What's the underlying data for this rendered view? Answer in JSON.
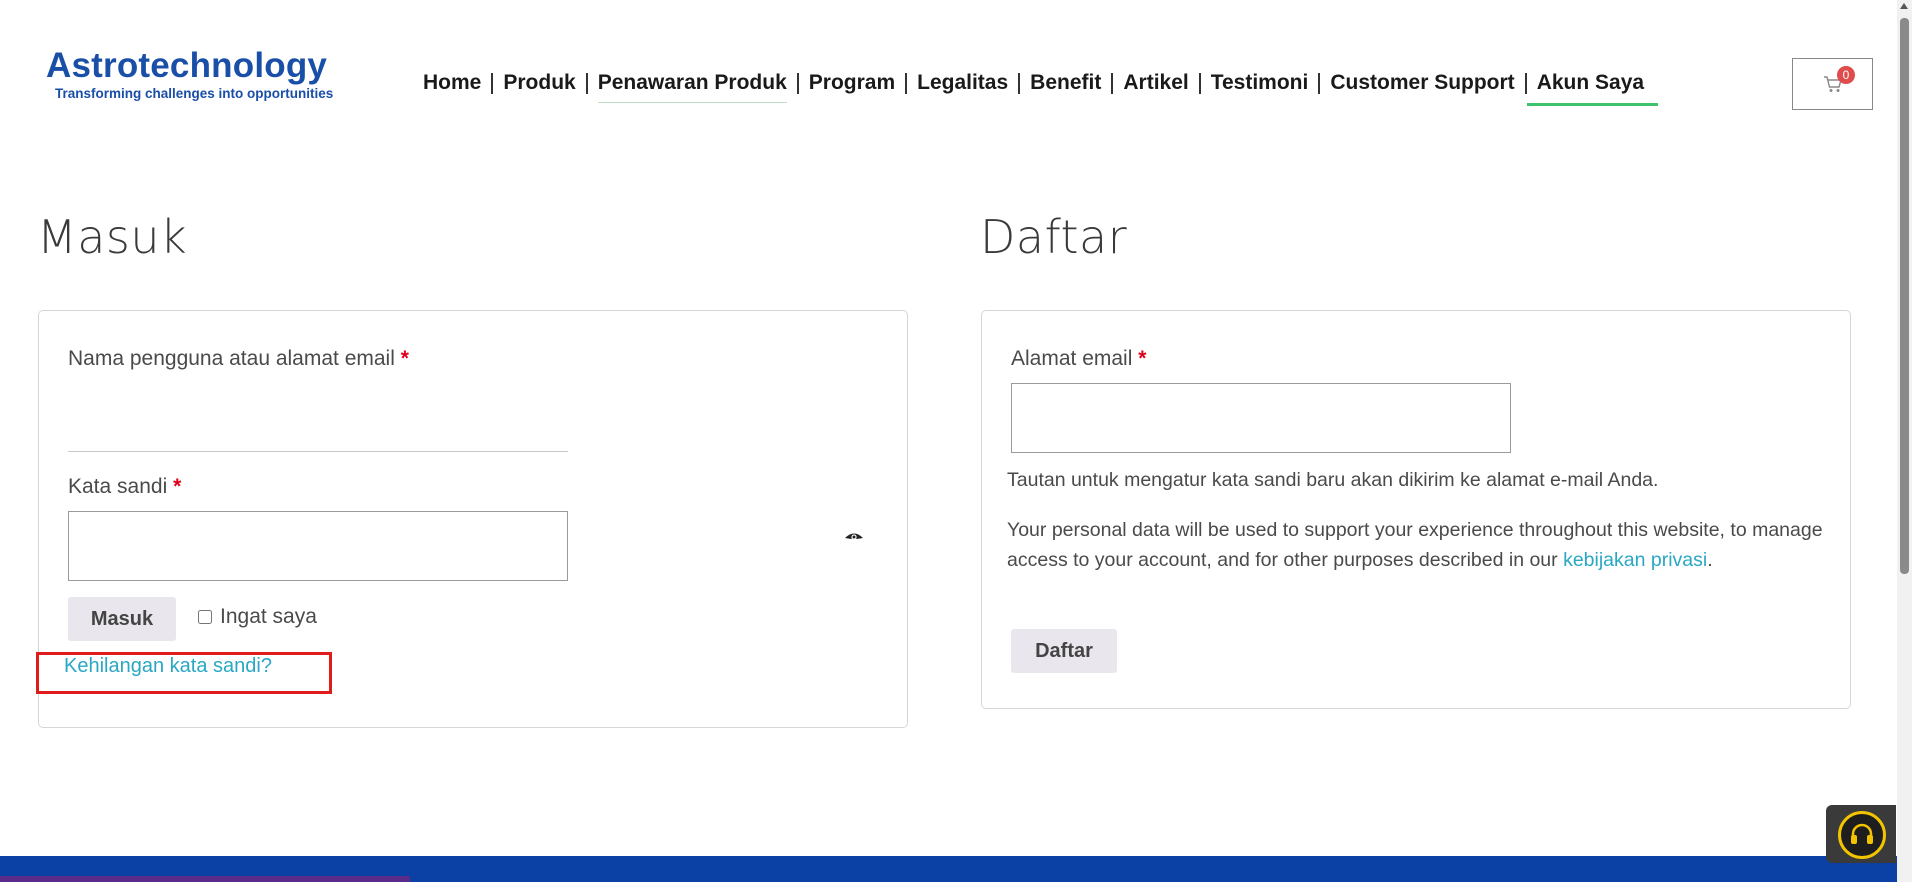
{
  "brand": {
    "name": "Astrotechnology",
    "tagline": "Transforming challenges into opportunities",
    "color": "#1a4fa8"
  },
  "nav": {
    "items": [
      {
        "label": "Home"
      },
      {
        "label": "Produk"
      },
      {
        "label": "Penawaran Produk"
      },
      {
        "label": "Program"
      },
      {
        "label": "Legalitas"
      },
      {
        "label": "Benefit"
      },
      {
        "label": "Artikel"
      },
      {
        "label": "Testimoni"
      },
      {
        "label": "Customer Support"
      },
      {
        "label": "Akun Saya"
      }
    ],
    "active": "Akun Saya",
    "active_color": "#3ec46d"
  },
  "cart": {
    "count": "0",
    "icon": "cart-icon",
    "badge_color": "#e04b4b"
  },
  "login": {
    "title": "Masuk",
    "username_label": "Nama pengguna atau alamat email",
    "username_value": "",
    "password_label": "Kata sandi",
    "password_value": "",
    "required_mark": "*",
    "submit_label": "Masuk",
    "remember_label": "Ingat saya",
    "remember_checked": false,
    "lost_password_link": "Kehilangan kata sandi?",
    "show_password_icon": "eye-icon"
  },
  "register": {
    "title": "Daftar",
    "email_label": "Alamat email",
    "email_value": "",
    "required_mark": "*",
    "info_text": "Tautan untuk mengatur kata sandi baru akan dikirim ke alamat e-mail Anda.",
    "privacy_text_1": "Your personal data will be used to support your experience throughout this website, to manage access to your account, and for other purposes described in our",
    "privacy_link": "kebijakan privasi",
    "privacy_text_end": ".",
    "submit_label": "Daftar"
  },
  "support_widget": {
    "icon": "headset-icon"
  },
  "colors": {
    "link": "#2aa7c4",
    "required": "#e0001b",
    "footer": "#0b41a4",
    "highlight": "#e01b1b"
  }
}
